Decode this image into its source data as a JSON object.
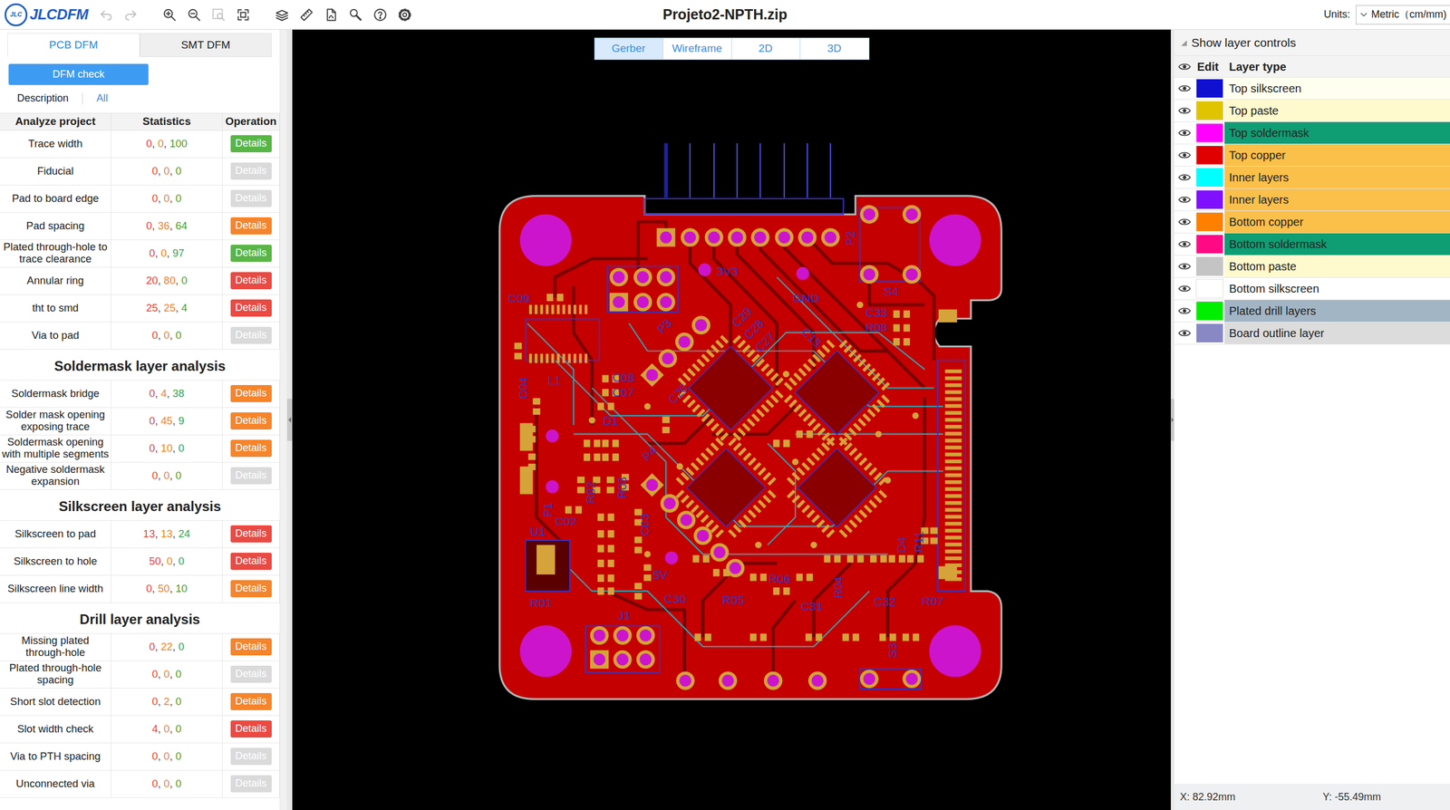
{
  "toolbar": {
    "logo_mark": "JLC",
    "logo": "JLCDFM",
    "title": "Projeto2-NPTH.zip",
    "units_label": "Units:",
    "units_value": "Metric（cm/mm)",
    "tools": [
      {
        "disabled": true
      },
      {
        "disabled": true
      },
      {
        "disabled": false
      },
      {
        "disabled": false
      },
      {
        "disabled": true
      },
      {
        "disabled": false
      },
      {
        "disabled": false
      },
      {
        "disabled": false
      },
      {
        "disabled": false
      },
      {
        "disabled": false
      },
      {
        "disabled": false
      },
      {
        "disabled": false
      }
    ]
  },
  "left_tabs": [
    {
      "label": "PCB DFM",
      "selected": true
    },
    {
      "label": "SMT DFM",
      "selected": false
    }
  ],
  "dfm_button": "DFM check",
  "filters": [
    {
      "label": "Description",
      "selected": false
    },
    {
      "label": "All",
      "selected": true
    }
  ],
  "table": {
    "columns": [
      "Analyze project",
      "Statistics",
      "Operation"
    ],
    "separator": ", ",
    "sections": [
      {
        "rows": [
          {
            "name": "Trace width",
            "stats": [
              "0",
              "0",
              "100"
            ],
            "kind": "pass",
            "action": "Details"
          },
          {
            "name": "Fiducial",
            "stats": [
              "0",
              "0",
              "0"
            ],
            "kind": "none",
            "action": "Details"
          },
          {
            "name": "Pad to board edge",
            "stats": [
              "0",
              "0",
              "0"
            ],
            "kind": "none",
            "action": "Details"
          },
          {
            "name": "Pad spacing",
            "stats": [
              "0",
              "36",
              "64"
            ],
            "kind": "warning",
            "action": "Details"
          },
          {
            "name": "Plated through-hole to trace clearance",
            "stats": [
              "0",
              "0",
              "97"
            ],
            "kind": "pass",
            "action": "Details"
          },
          {
            "name": "Annular ring",
            "stats": [
              "20",
              "80",
              "0"
            ],
            "kind": "danger",
            "action": "Details"
          },
          {
            "name": "tht to smd",
            "stats": [
              "25",
              "25",
              "4"
            ],
            "kind": "danger",
            "action": "Details"
          },
          {
            "name": "Via to pad",
            "stats": [
              "0",
              "0",
              "0"
            ],
            "kind": "none",
            "action": "Details"
          }
        ]
      },
      {
        "title": "Soldermask layer analysis",
        "rows": [
          {
            "name": "Soldermask bridge",
            "stats": [
              "0",
              "4",
              "38"
            ],
            "kind": "warning",
            "action": "Details"
          },
          {
            "name": "Solder mask opening exposing trace",
            "stats": [
              "0",
              "45",
              "9"
            ],
            "kind": "warning",
            "action": "Details"
          },
          {
            "name": "Soldermask opening with multiple segments",
            "stats": [
              "0",
              "10",
              "0"
            ],
            "kind": "warning",
            "action": "Details"
          },
          {
            "name": "Negative soldermask expansion",
            "stats": [
              "0",
              "0",
              "0"
            ],
            "kind": "none",
            "action": "Details"
          }
        ]
      },
      {
        "title": "Silkscreen layer analysis",
        "rows": [
          {
            "name": "Silkscreen to pad",
            "stats": [
              "13",
              "13",
              "24"
            ],
            "kind": "danger",
            "action": "Details"
          },
          {
            "name": "Silkscreen to hole",
            "stats": [
              "50",
              "0",
              "0"
            ],
            "kind": "danger",
            "action": "Details"
          },
          {
            "name": "Silkscreen line width",
            "stats": [
              "0",
              "50",
              "10"
            ],
            "kind": "warning",
            "action": "Details"
          }
        ]
      },
      {
        "title": "Drill layer analysis",
        "rows": [
          {
            "name": "Missing plated through-hole",
            "stats": [
              "0",
              "22",
              "0"
            ],
            "kind": "warning",
            "action": "Details"
          },
          {
            "name": "Plated through-hole spacing",
            "stats": [
              "0",
              "0",
              "0"
            ],
            "kind": "none",
            "action": "Details"
          },
          {
            "name": "Short slot detection",
            "stats": [
              "0",
              "2",
              "0"
            ],
            "kind": "warning",
            "action": "Details"
          },
          {
            "name": "Slot width check",
            "stats": [
              "4",
              "0",
              "0"
            ],
            "kind": "danger",
            "action": "Details"
          },
          {
            "name": "Via to PTH spacing",
            "stats": [
              "0",
              "0",
              "0"
            ],
            "kind": "none",
            "action": "Details"
          },
          {
            "name": "Unconnected via",
            "stats": [
              "0",
              "0",
              "0"
            ],
            "kind": "none",
            "action": "Details"
          }
        ]
      }
    ]
  },
  "views": [
    {
      "label": "Gerber",
      "selected": true
    },
    {
      "label": "Wireframe",
      "selected": false
    },
    {
      "label": "2D",
      "selected": false
    },
    {
      "label": "3D",
      "selected": false
    }
  ],
  "board": {
    "labels": [
      "3V3",
      "GND",
      "C09",
      "L1",
      "C04",
      "C08",
      "C07",
      "D1",
      "P3",
      "C29",
      "C28",
      "C27",
      "C26",
      "C15",
      "C33",
      "R08",
      "S4",
      "P1",
      "R02",
      "R03",
      "C02",
      "C03",
      "U1",
      "R01",
      "J1",
      "P4",
      "5V",
      "C30",
      "R05",
      "R06",
      "C31",
      "R04",
      "C32",
      "R07",
      "S3",
      "P2",
      "D4",
      "R11"
    ]
  },
  "layers": {
    "toggle": "◢",
    "header": "Show layer controls",
    "columns": [
      "Edit",
      "Layer type"
    ],
    "items": [
      {
        "name": "Top silkscreen",
        "visible": true,
        "color": "#1010d0",
        "highlight": "#fffff0"
      },
      {
        "name": "Top paste",
        "visible": true,
        "color": "#e0c400",
        "highlight": "#fffacd"
      },
      {
        "name": "Top soldermask",
        "visible": true,
        "color": "#ff00ff",
        "highlight": "#0f9d74"
      },
      {
        "name": "Top copper",
        "visible": true,
        "color": "#e00000",
        "highlight": "#fbc04a"
      },
      {
        "name": "Inner layers",
        "visible": true,
        "color": "#00ffff",
        "highlight": "#fbc04a"
      },
      {
        "name": "Inner layers",
        "visible": true,
        "color": "#8010ff",
        "highlight": "#fbc04a"
      },
      {
        "name": "Bottom copper",
        "visible": true,
        "color": "#ff8000",
        "highlight": "#fbc04a"
      },
      {
        "name": "Bottom soldermask",
        "visible": true,
        "color": "#ff0a84",
        "highlight": "#0f9d74"
      },
      {
        "name": "Bottom paste",
        "visible": true,
        "color": "#c4c4c4",
        "highlight": "#fffacd"
      },
      {
        "name": "Bottom silkscreen",
        "visible": true,
        "color": "#ffffff",
        "highlight": "#ffffff"
      },
      {
        "name": "Plated drill layers",
        "visible": true,
        "color": "#00ee00",
        "highlight": "#a2b5c4"
      },
      {
        "name": "Board outline layer",
        "visible": true,
        "color": "#8888c4",
        "highlight": "#dcdcdc"
      }
    ]
  },
  "cursor": {
    "x": "X: 82.92mm",
    "y": "Y: -55.49mm"
  }
}
